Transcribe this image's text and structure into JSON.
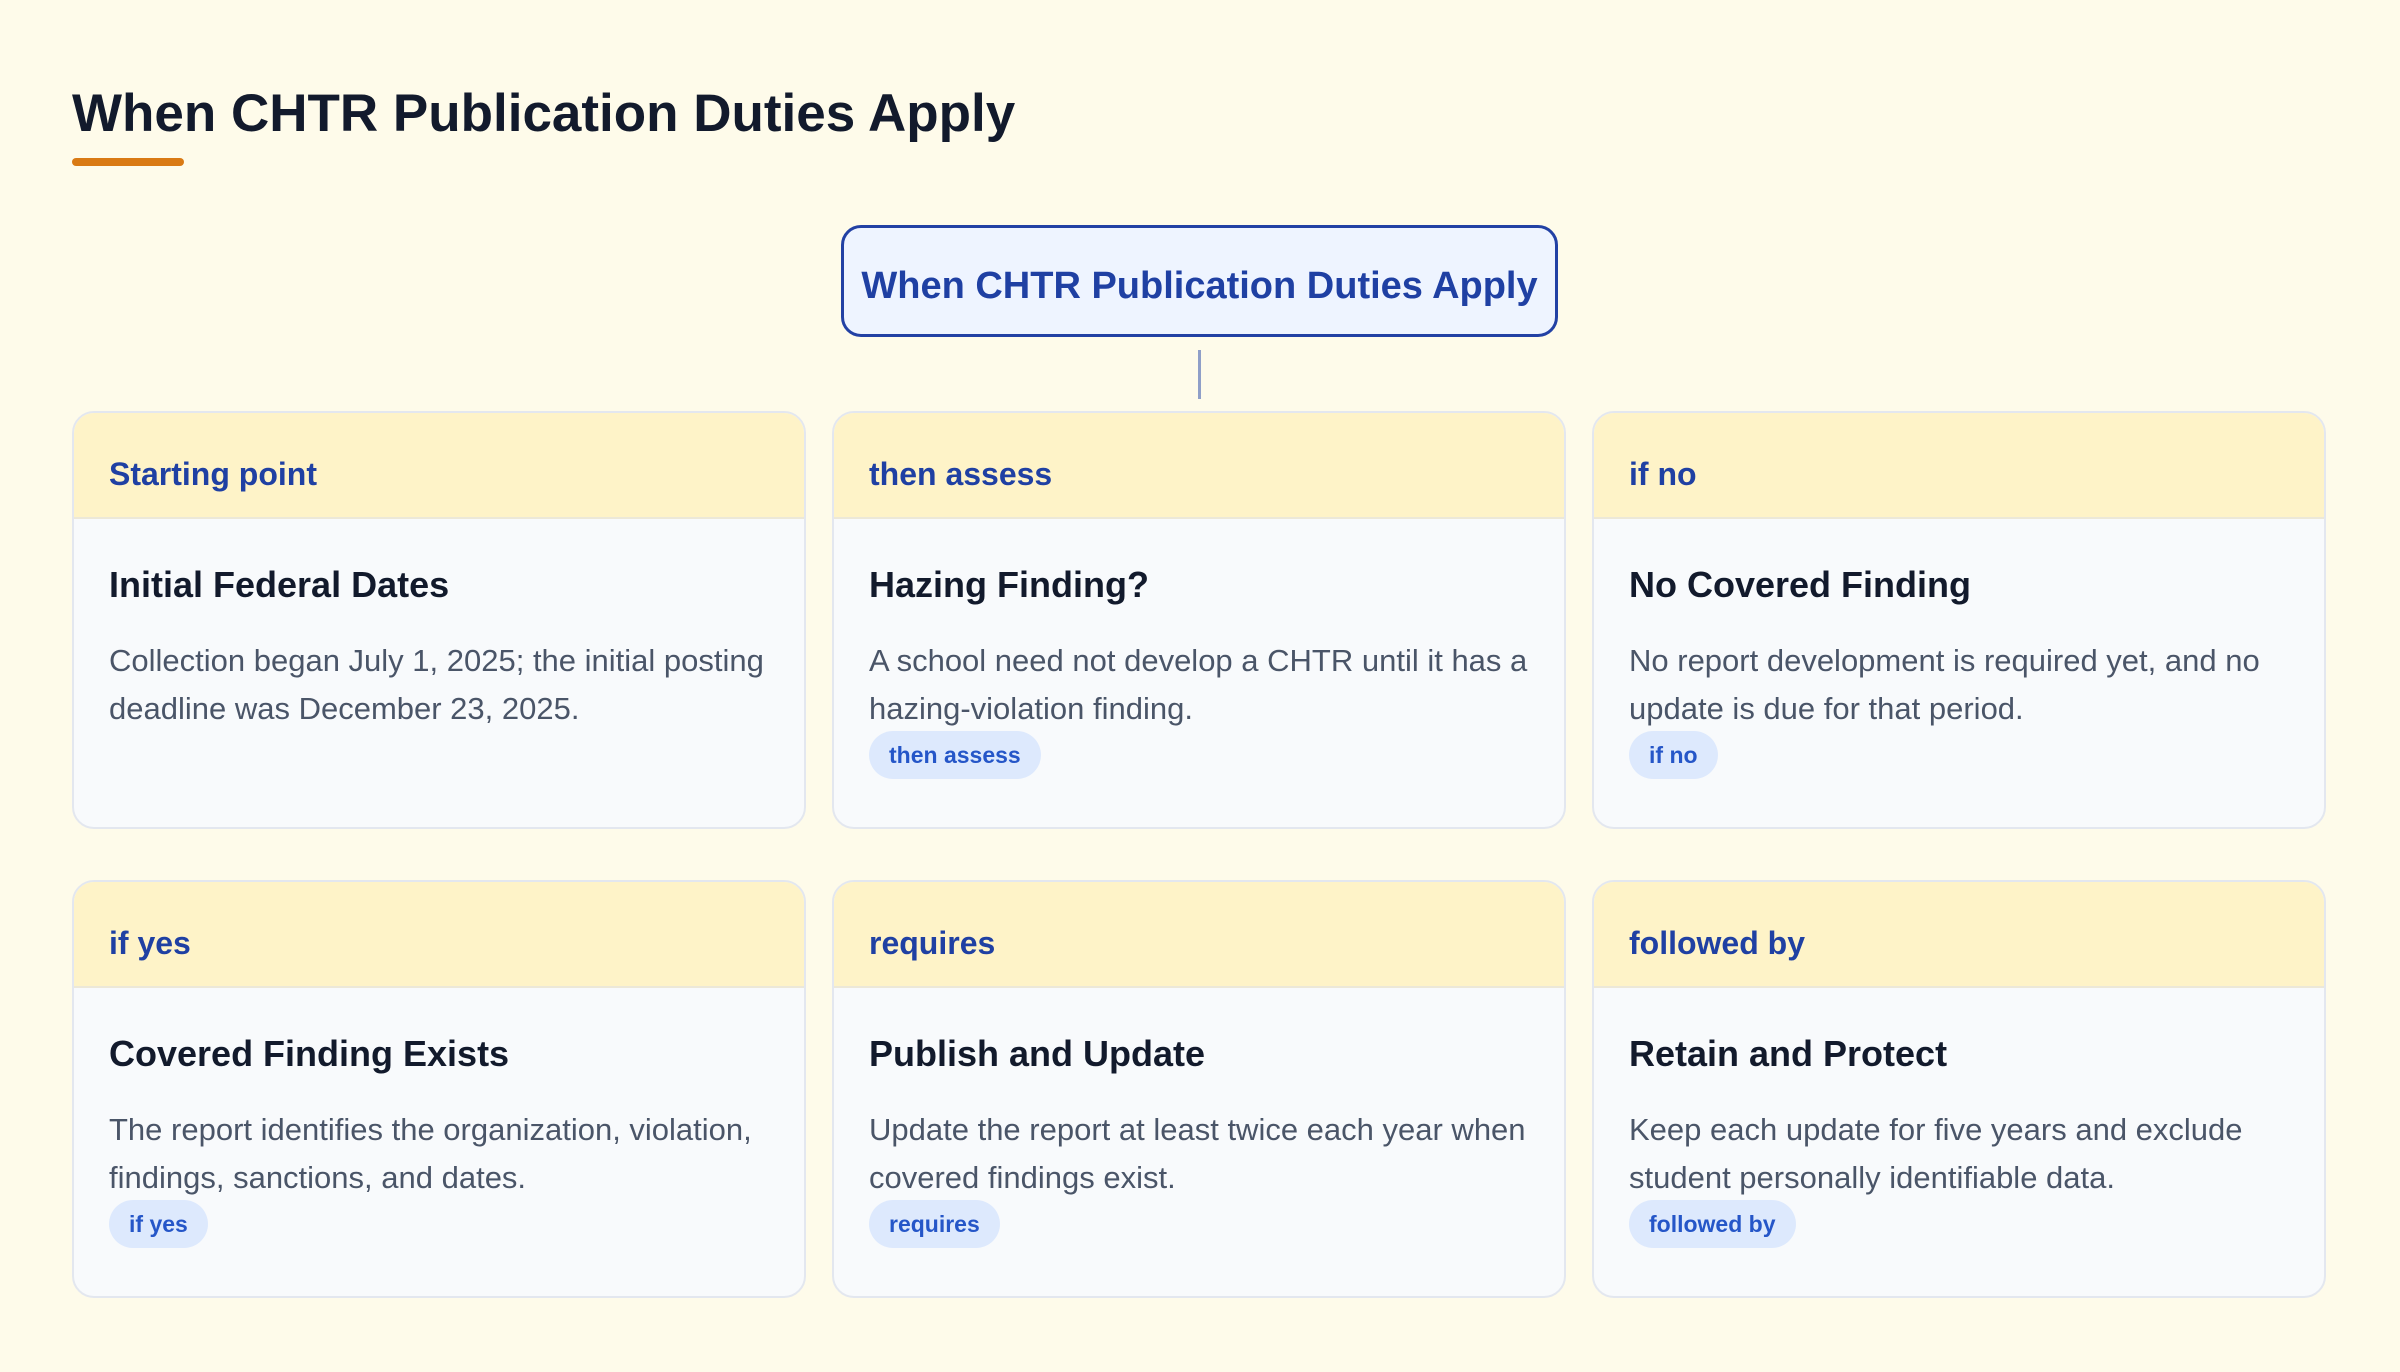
{
  "page": {
    "title": "When CHTR Publication Duties Apply"
  },
  "diagram": {
    "root_label": "When CHTR Publication Duties Apply",
    "nodes": [
      {
        "tag": "Starting point",
        "title": "Initial Federal Dates",
        "description": "Collection began July 1, 2025; the initial posting deadline was December 23, 2025.",
        "badge": ""
      },
      {
        "tag": "then assess",
        "title": "Hazing Finding?",
        "description": "A school need not develop a CHTR until it has a hazing-violation finding.",
        "badge": "then assess"
      },
      {
        "tag": "if no",
        "title": "No Covered Finding",
        "description": "No report development is required yet, and no update is due for that period.",
        "badge": "if no"
      },
      {
        "tag": "if yes",
        "title": "Covered Finding Exists",
        "description": "The report identifies the organization, violation, findings, sanctions, and dates.",
        "badge": "if yes"
      },
      {
        "tag": "requires",
        "title": "Publish and Update",
        "description": "Update the report at least twice each year when covered findings exist.",
        "badge": "requires"
      },
      {
        "tag": "followed by",
        "title": "Retain and Protect",
        "description": "Keep each update for five years and exclude student personally identifiable data.",
        "badge": "followed by"
      }
    ]
  },
  "colors": {
    "background": "#fefbea",
    "accent_underline": "#d97a14",
    "root_border": "#2241a4",
    "header_band": "#fef3c8",
    "badge_bg": "#dde9fd",
    "badge_text": "#2556c8"
  }
}
